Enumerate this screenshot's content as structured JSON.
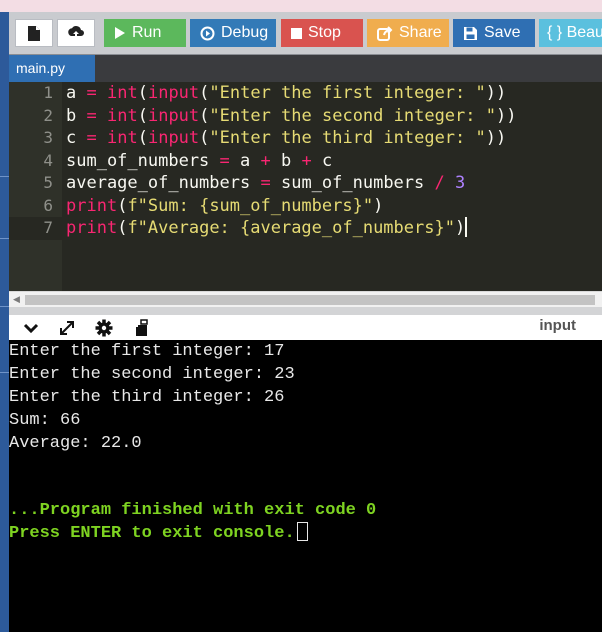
{
  "toolbar": {
    "run_label": "Run",
    "debug_label": "Debug",
    "stop_label": "Stop",
    "share_label": "Share",
    "save_label": "Save",
    "beautify_label": "{ } Beau",
    "colors": {
      "run": "#5cb85c",
      "debug": "#337ab7",
      "stop": "#d9534f",
      "share": "#f0ad4e",
      "save": "#2f6fb3",
      "beautify": "#5bc0de"
    }
  },
  "tabs": [
    {
      "label": "main.py"
    }
  ],
  "editor": {
    "lines": [
      {
        "num": "1",
        "tokens": [
          [
            "a",
            "v"
          ],
          [
            " ",
            "v"
          ],
          [
            "=",
            "o"
          ],
          [
            " ",
            "v"
          ],
          [
            "int",
            "k"
          ],
          [
            "(",
            "v"
          ],
          [
            "input",
            "k"
          ],
          [
            "(",
            "v"
          ],
          [
            "\"Enter the first integer: \"",
            "s"
          ],
          [
            "))",
            "v"
          ]
        ]
      },
      {
        "num": "2",
        "tokens": [
          [
            "b",
            "v"
          ],
          [
            " ",
            "v"
          ],
          [
            "=",
            "o"
          ],
          [
            " ",
            "v"
          ],
          [
            "int",
            "k"
          ],
          [
            "(",
            "v"
          ],
          [
            "input",
            "k"
          ],
          [
            "(",
            "v"
          ],
          [
            "\"Enter the second integer: \"",
            "s"
          ],
          [
            "))",
            "v"
          ]
        ]
      },
      {
        "num": "3",
        "tokens": [
          [
            "c",
            "v"
          ],
          [
            " ",
            "v"
          ],
          [
            "=",
            "o"
          ],
          [
            " ",
            "v"
          ],
          [
            "int",
            "k"
          ],
          [
            "(",
            "v"
          ],
          [
            "input",
            "k"
          ],
          [
            "(",
            "v"
          ],
          [
            "\"Enter the third integer: \"",
            "s"
          ],
          [
            "))",
            "v"
          ]
        ]
      },
      {
        "num": "4",
        "tokens": [
          [
            "sum_of_numbers",
            "v"
          ],
          [
            " ",
            "v"
          ],
          [
            "=",
            "o"
          ],
          [
            " a ",
            "v"
          ],
          [
            "+",
            "o"
          ],
          [
            " b ",
            "v"
          ],
          [
            "+",
            "o"
          ],
          [
            " c",
            "v"
          ]
        ]
      },
      {
        "num": "5",
        "tokens": [
          [
            "average_of_numbers",
            "v"
          ],
          [
            " ",
            "v"
          ],
          [
            "=",
            "o"
          ],
          [
            " sum_of_numbers ",
            "v"
          ],
          [
            "/",
            "o"
          ],
          [
            " ",
            "v"
          ],
          [
            "3",
            "n"
          ]
        ]
      },
      {
        "num": "6",
        "tokens": [
          [
            "print",
            "k"
          ],
          [
            "(",
            "v"
          ],
          [
            "f\"Sum: {sum_of_numbers}\"",
            "s"
          ],
          [
            ")",
            "v"
          ]
        ]
      },
      {
        "num": "7",
        "tokens": [
          [
            "print",
            "k"
          ],
          [
            "(",
            "v"
          ],
          [
            "f\"Average: {average_of_numbers}\"",
            "s"
          ],
          [
            ")",
            "v"
          ]
        ]
      }
    ],
    "colors": {
      "v": "#f8f8f2",
      "o": "#f92672",
      "k": "#f92672",
      "s": "#e6db74",
      "n": "#ae81ff"
    }
  },
  "console": {
    "input_label": "input",
    "output_lines": [
      "Enter the first integer: 17",
      "Enter the second integer: 23",
      "Enter the third integer: 26",
      "Sum: 66",
      "Average: 22.0"
    ],
    "finished_text": "...Program finished with exit code 0",
    "press_text": "Press ENTER to exit console."
  }
}
